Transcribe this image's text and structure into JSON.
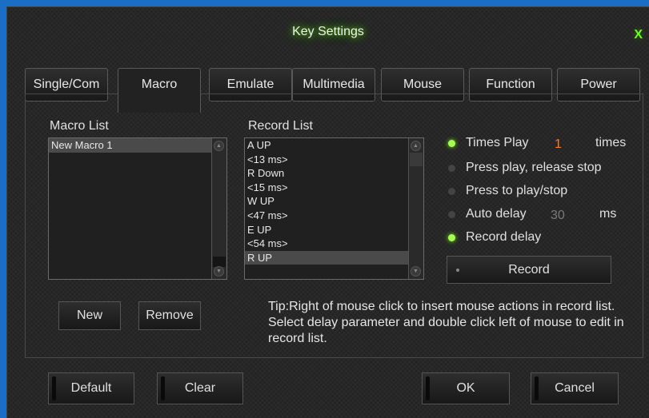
{
  "window": {
    "title": "Key Settings",
    "close_label": "X"
  },
  "tabs": [
    {
      "label": "Single/Com",
      "active": false
    },
    {
      "label": "Macro",
      "active": true
    },
    {
      "label": "Emulate",
      "active": false
    },
    {
      "label": "Multimedia",
      "active": false
    },
    {
      "label": "Mouse",
      "active": false
    },
    {
      "label": "Function",
      "active": false
    },
    {
      "label": "Power",
      "active": false
    }
  ],
  "macro_list": {
    "label": "Macro List",
    "items": [
      "New Macro 1"
    ],
    "selected_index": 0
  },
  "record_list": {
    "label": "Record List",
    "items": [
      "A UP",
      "<13 ms>",
      "R Down",
      "<15 ms>",
      "W UP",
      "<47 ms>",
      "E UP",
      "<54 ms>",
      "R UP"
    ],
    "selected_index": 8
  },
  "options": {
    "times_play": {
      "label": "Times Play",
      "value": "1",
      "unit": "times",
      "checked": true
    },
    "press_play_release_stop": {
      "label": "Press play, release stop",
      "checked": false
    },
    "press_to_play_stop": {
      "label": "Press to play/stop",
      "checked": false
    },
    "auto_delay": {
      "label": "Auto delay",
      "value": "30",
      "unit": "ms",
      "checked": false
    },
    "record_delay": {
      "label": "Record delay",
      "checked": true
    }
  },
  "buttons": {
    "record": "Record",
    "new": "New",
    "remove": "Remove",
    "default": "Default",
    "clear": "Clear",
    "ok": "OK",
    "cancel": "Cancel"
  },
  "tip": "Tip:Right of mouse click to insert mouse actions in record list. Select delay parameter and double click left of mouse to edit in record list.",
  "colors": {
    "accent_green": "#a6ff55",
    "number_orange": "#ff7a1a",
    "background": "#222222",
    "frame_blue": "#1a6fc4"
  }
}
